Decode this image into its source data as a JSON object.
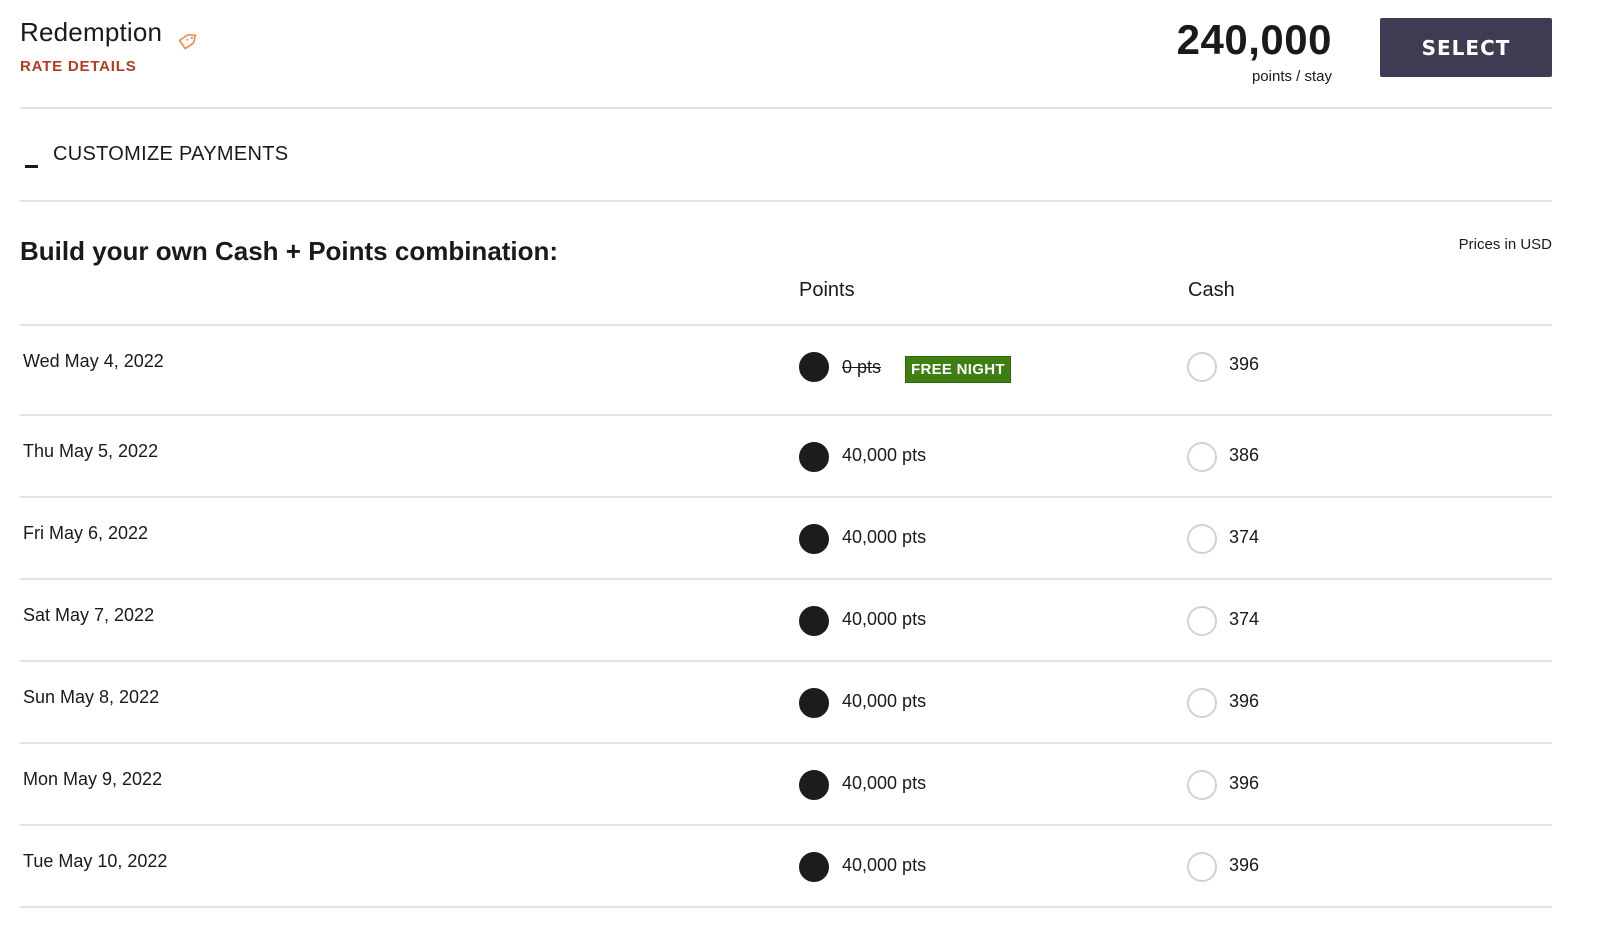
{
  "header": {
    "rate_name": "Redemption",
    "rate_details_link": "RATE DETAILS",
    "points_total": "240,000",
    "points_unit": "points / stay",
    "select_label": "SELECT"
  },
  "customize": {
    "label": "CUSTOMIZE PAYMENTS"
  },
  "build": {
    "title": "Build your own Cash + Points combination:",
    "prices_note": "Prices in USD",
    "col_points": "Points",
    "col_cash": "Cash"
  },
  "rows": [
    {
      "date": "Wed May 4, 2022",
      "points": "0 pts",
      "badge": "FREE NIGHT",
      "cash": "396",
      "selected": "points"
    },
    {
      "date": "Thu May 5, 2022",
      "points": "40,000 pts",
      "cash": "386",
      "selected": "points"
    },
    {
      "date": "Fri May 6, 2022",
      "points": "40,000 pts",
      "cash": "374",
      "selected": "points"
    },
    {
      "date": "Sat May 7, 2022",
      "points": "40,000 pts",
      "cash": "374",
      "selected": "points"
    },
    {
      "date": "Sun May 8, 2022",
      "points": "40,000 pts",
      "cash": "396",
      "selected": "points"
    },
    {
      "date": "Mon May 9, 2022",
      "points": "40,000 pts",
      "cash": "396",
      "selected": "points"
    },
    {
      "date": "Tue May 10, 2022",
      "points": "40,000 pts",
      "cash": "396",
      "selected": "points"
    }
  ],
  "colors": {
    "accent_red": "#b8391f",
    "select_button": "#3f3b52",
    "free_night_badge": "#3f7e12",
    "tag_icon": "#f08a4b"
  },
  "icons": {
    "tag": "tag-icon",
    "collapse": "minus-icon"
  }
}
